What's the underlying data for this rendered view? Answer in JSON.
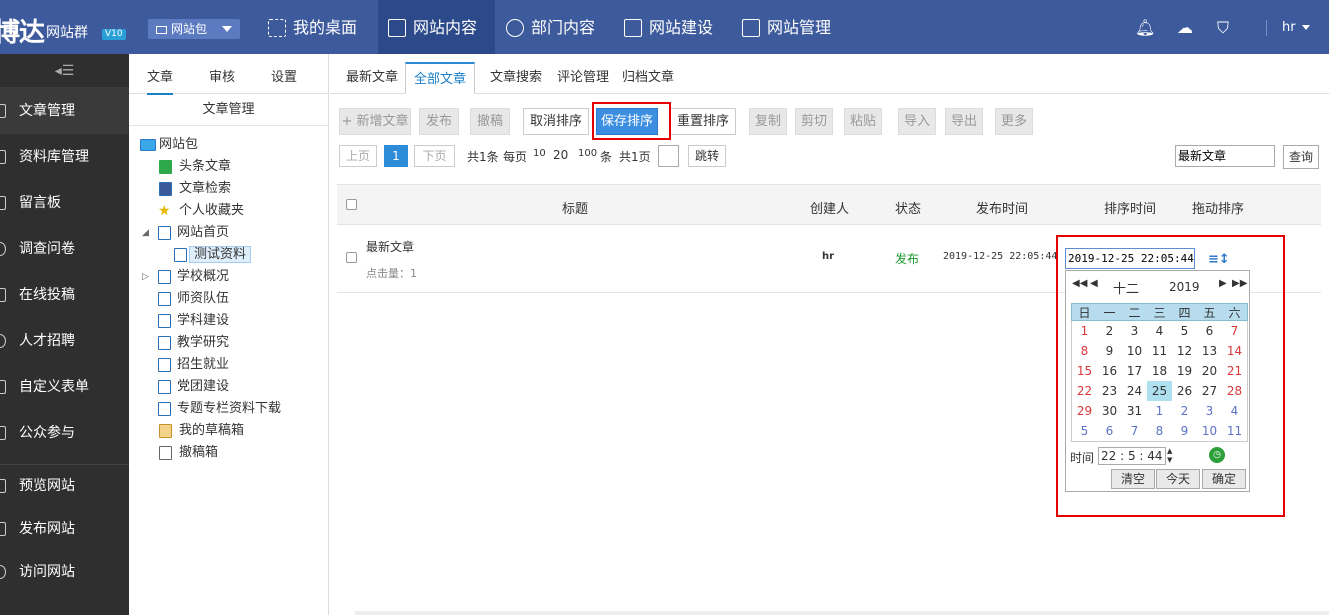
{
  "brand": {
    "logo_text": "博达",
    "sub": "网站群",
    "version": "V10"
  },
  "site_selector": {
    "label": "网站包"
  },
  "nav": [
    {
      "label": "我的桌面",
      "icon": "grid-icon"
    },
    {
      "label": "网站内容",
      "icon": "edit-icon"
    },
    {
      "label": "部门内容",
      "icon": "org-icon"
    },
    {
      "label": "网站建设",
      "icon": "build-icon"
    },
    {
      "label": "网站管理",
      "icon": "manage-icon"
    }
  ],
  "user": {
    "name": "hr"
  },
  "sidebar": {
    "items": [
      {
        "label": "文章管理"
      },
      {
        "label": "资料库管理"
      },
      {
        "label": "留言板"
      },
      {
        "label": "调查问卷"
      },
      {
        "label": "在线投稿"
      },
      {
        "label": "人才招聘"
      },
      {
        "label": "自定义表单"
      },
      {
        "label": "公众参与"
      }
    ],
    "bottom_items": [
      {
        "label": "预览网站"
      },
      {
        "label": "发布网站"
      },
      {
        "label": "访问网站"
      }
    ]
  },
  "panel": {
    "tabs": [
      "文章",
      "审核",
      "设置"
    ],
    "title": "文章管理",
    "tree": {
      "root": "网站包",
      "nodes": [
        "头条文章",
        "文章检索",
        "个人收藏夹",
        "网站首页",
        "测试资料",
        "学校概况",
        "师资队伍",
        "学科建设",
        "教学研究",
        "招生就业",
        "党团建设",
        "专题专栏资料下载",
        "我的草稿箱",
        "撤稿箱"
      ]
    }
  },
  "main": {
    "tabs": [
      "最新文章",
      "全部文章",
      "文章搜索",
      "评论管理",
      "归档文章"
    ],
    "toolbar": {
      "add": "+ 新增文章",
      "publish": "发布",
      "withdraw": "撤稿",
      "cancel_sort": "取消排序",
      "save_sort": "保存排序",
      "reset_sort": "重置排序",
      "copy": "复制",
      "cut": "剪切",
      "paste": "粘贴",
      "import": "导入",
      "export": "导出",
      "more": "更多"
    },
    "pager": {
      "prev": "上页",
      "current": "1",
      "next": "下页",
      "total": "共1条",
      "per_page": "每页",
      "opt10": "10",
      "opt20": "20",
      "opt100": "100",
      "unit": "条",
      "pages": "共1页",
      "go": "跳转"
    },
    "search": {
      "value": "最新文章",
      "button": "查询"
    },
    "table": {
      "headers": [
        "标题",
        "创建人",
        "状态",
        "发布时间",
        "排序时间",
        "拖动排序"
      ],
      "rows": [
        {
          "title": "最新文章",
          "clicks": "点击量：1",
          "creator": "hr",
          "status": "发布",
          "publish_time": "2019-12-25 22:05:44",
          "sort_time": "2019-12-25 22:05:44"
        }
      ]
    },
    "calendar": {
      "month": "十二",
      "year": "2019",
      "weekdays": [
        "日",
        "一",
        "二",
        "三",
        "四",
        "五",
        "六"
      ],
      "weeks": [
        [
          "1",
          "2",
          "3",
          "4",
          "5",
          "6",
          "7"
        ],
        [
          "8",
          "9",
          "10",
          "11",
          "12",
          "13",
          "14"
        ],
        [
          "15",
          "16",
          "17",
          "18",
          "19",
          "20",
          "21"
        ],
        [
          "22",
          "23",
          "24",
          "25",
          "26",
          "27",
          "28"
        ],
        [
          "29",
          "30",
          "31",
          "1",
          "2",
          "3",
          "4"
        ],
        [
          "5",
          "6",
          "7",
          "8",
          "9",
          "10",
          "11"
        ]
      ],
      "selected_day": "25",
      "time_label": "时间",
      "time": "22 : 5 : 44",
      "buttons": [
        "清空",
        "今天",
        "确定"
      ]
    }
  },
  "colors": {
    "topbar": "#3d5b9c",
    "sidebar": "#2f2f2f",
    "accent": "#3c8ee0",
    "highlight": "#e60000",
    "status_publish": "#1a9a2a"
  }
}
